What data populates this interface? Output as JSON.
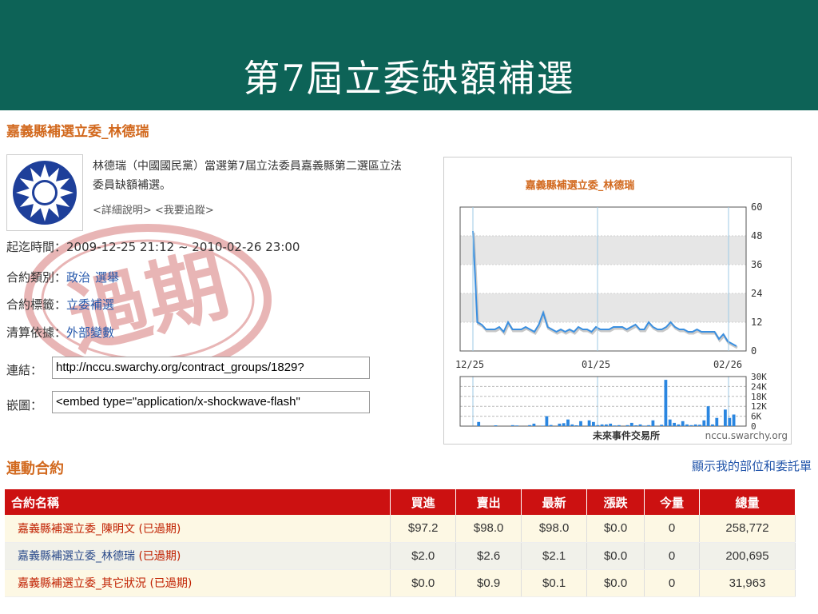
{
  "slide": {
    "title": "第7屆立委缺額補選"
  },
  "market": {
    "title": "嘉義縣補選立委_林德瑞",
    "description": "林德瑞（中國國民黨）當選第7屆立法委員嘉義縣第二選區立法委員缺額補選。",
    "links": [
      "<詳細說明>",
      "<我要追蹤>"
    ],
    "watermark_text": "過期",
    "info": {
      "period_label": "起迄時間：",
      "period_value": "2009-12-25 21:12 ~ 2010-02-26 23:00",
      "category_label": "合約類別：",
      "category_values": [
        "政治",
        "選舉"
      ],
      "tag_label": "合約標籤：",
      "tag_value": "立委補選",
      "settlement_label": "清算依據：",
      "settlement_value": "外部變數"
    },
    "link_field": {
      "label": "連結：",
      "value": "http://nccu.swarchy.org/contract_groups/1829?"
    },
    "embed_field": {
      "label": "嵌圖：",
      "value": "<embed type=\"application/x-shockwave-flash\""
    }
  },
  "chart_data": {
    "type": "line",
    "title": "嘉義縣補選立委_林德瑞",
    "x_ticks": [
      "12/25",
      "01/25",
      "02/26"
    ],
    "y_ticks": [
      0,
      12,
      24,
      36,
      48,
      60
    ],
    "ylim": [
      0,
      60
    ],
    "price_series": {
      "values": [
        50,
        12,
        11,
        9,
        9,
        9,
        10,
        8,
        12,
        9,
        9,
        9,
        10,
        9,
        8,
        11,
        16,
        10,
        9,
        8,
        9,
        8,
        9,
        8,
        10,
        9,
        9,
        8,
        10,
        9,
        9,
        9,
        10,
        10,
        10,
        9,
        10,
        11,
        9,
        9,
        12,
        10,
        9,
        9,
        10,
        12,
        10,
        9,
        9,
        8,
        8,
        9,
        8,
        8,
        8,
        8,
        5,
        7,
        4,
        3,
        2
      ]
    },
    "volume_series": {
      "y_ticks": [
        "0",
        "6K",
        "12K",
        "18K",
        "24K",
        "30K"
      ],
      "ylim": [
        0,
        30000
      ],
      "values": [
        0,
        2500,
        0,
        0,
        0,
        500,
        0,
        0,
        0,
        600,
        400,
        0,
        0,
        600,
        1500,
        0,
        300,
        6000,
        700,
        0,
        1500,
        1800,
        4000,
        1000,
        500,
        3000,
        0,
        3500,
        2500,
        600,
        1000,
        1000,
        1500,
        400,
        600,
        0,
        600,
        2000,
        500,
        1000,
        300,
        600,
        3500,
        0,
        800,
        28000,
        4000,
        2000,
        1000,
        3000,
        1000,
        600,
        1000,
        800,
        3500,
        12000,
        1000,
        5000,
        0,
        10000,
        5000,
        7000
      ]
    },
    "grid": true,
    "footer": {
      "brand": "未來事件交易所",
      "site": "nccu.swarchy.org"
    }
  },
  "linked": {
    "title": "連動合約",
    "my_orders_link": "顯示我的部位和委託單",
    "headers": [
      "合約名稱",
      "買進",
      "賣出",
      "最新",
      "漲跌",
      "今量",
      "總量"
    ],
    "rows": [
      {
        "name": "嘉義縣補選立委_陳明文",
        "status": "(已過期)",
        "bid": "$97.2",
        "ask": "$98.0",
        "last": "$98.0",
        "change": "$0.0",
        "today": "0",
        "total": "258,772"
      },
      {
        "name": "嘉義縣補選立委_林德瑞",
        "status": "(已過期)",
        "bid": "$2.0",
        "ask": "$2.6",
        "last": "$2.1",
        "change": "$0.0",
        "today": "0",
        "total": "200,695"
      },
      {
        "name": "嘉義縣補選立委_其它狀況",
        "status": "(已過期)",
        "bid": "$0.0",
        "ask": "$0.9",
        "last": "$0.1",
        "change": "$0.0",
        "today": "0",
        "total": "31,963"
      }
    ]
  }
}
